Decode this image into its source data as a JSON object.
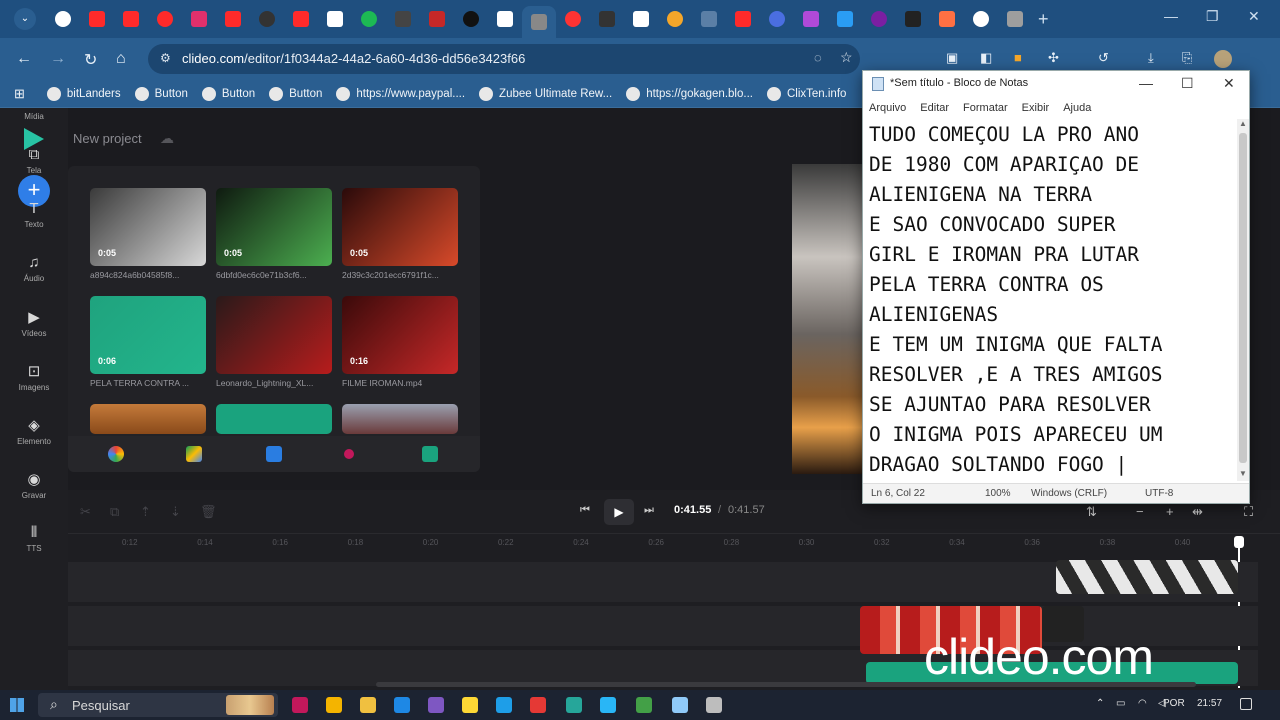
{
  "browser": {
    "url_domain": "clideo.com",
    "url_path": "/editor/1f0344a2-44a2-6a60-4d36-dd56e3423f66",
    "tab_colors": [
      "#ffffff",
      "#ff2a2a",
      "#ff2a2a",
      "#ff2a2a",
      "#e1306c",
      "#ff2a2a",
      "#333333",
      "#ff2a2a",
      "#ffffff",
      "#1db954",
      "#444444",
      "#c62828",
      "#111111",
      "#ffffff",
      "#888888",
      "#ff3333",
      "#333333",
      "#ffffff",
      "#f4a62a",
      "#5b7fa6",
      "#ff2a2a",
      "#4a6ee0",
      "#b04ad8",
      "#2a9df4",
      "#7b1fa2",
      "#222222",
      "#ff7043",
      "#ffffff",
      "#9e9e9e"
    ],
    "bookmarks": [
      "bitLanders",
      "Button",
      "Button",
      "Button",
      "https://www.paypal....",
      "Zubee Ultimate Rew...",
      "https://gokagen.blo...",
      "ClixTen.info"
    ]
  },
  "app": {
    "project_name": "New project",
    "sidebar": [
      {
        "icon": "image-icon",
        "glyph": "▣",
        "label": "Mídia"
      },
      {
        "icon": "screen-icon",
        "glyph": "⧉",
        "label": "Tela"
      },
      {
        "icon": "text-icon",
        "glyph": "T",
        "label": "Texto"
      },
      {
        "icon": "music-icon",
        "glyph": "♫",
        "label": "Áudio"
      },
      {
        "icon": "video-icon",
        "glyph": "▶",
        "label": "Vídeos"
      },
      {
        "icon": "picture-icon",
        "glyph": "⊡",
        "label": "Imagens"
      },
      {
        "icon": "shapes-icon",
        "glyph": "◈",
        "label": "Elemento"
      },
      {
        "icon": "record-icon",
        "glyph": "◉",
        "label": "Gravar"
      },
      {
        "icon": "tts-icon",
        "glyph": "⦀",
        "label": "TTS"
      }
    ],
    "media": [
      {
        "name": "a894c824a6b04585f8...",
        "duration": "0:05",
        "colors": [
          "#3a3a3a",
          "#d8d8d8"
        ]
      },
      {
        "name": "6dbfd0ec6c0e71b3cf6...",
        "duration": "0:05",
        "colors": [
          "#0f1a10",
          "#4caf50"
        ]
      },
      {
        "name": "2d39c3c201ecc6791f1c...",
        "duration": "0:05",
        "colors": [
          "#2a0a0a",
          "#d84a2a"
        ]
      },
      {
        "name": "PELA TERRA CONTRA ...",
        "duration": "0:06",
        "colors": [
          "#1fa37e",
          "#23b58c"
        ]
      },
      {
        "name": "Leonardo_Lightning_XL...",
        "duration": "",
        "colors": [
          "#2a1a1a",
          "#b71c1c"
        ]
      },
      {
        "name": "FILME IROMAN.mp4",
        "duration": "0:16",
        "colors": [
          "#3a0a0a",
          "#c62828"
        ]
      }
    ],
    "timecode_current": "0:41.55",
    "timecode_total": "0:41.57",
    "ruler_ticks": [
      "0:12",
      "0:14",
      "0:16",
      "0:18",
      "0:20",
      "0:22",
      "0:24",
      "0:26",
      "0:28",
      "0:30",
      "0:32",
      "0:34",
      "0:36",
      "0:38",
      "0:40"
    ],
    "watermark": "clideo.com"
  },
  "notepad": {
    "title": "*Sem título - Bloco de Notas",
    "menu": [
      "Arquivo",
      "Editar",
      "Formatar",
      "Exibir",
      "Ajuda"
    ],
    "lines": [
      "TUDO COMEÇOU LA PRO ANO",
      "DE 1980 COM APARIÇAO DE",
      "ALIENIGENA NA TERRA",
      "E SAO CONVOCADO SUPER",
      "GIRL E IROMAN PRA LUTAR",
      "PELA TERRA CONTRA OS",
      "ALIENIGENAS",
      "E TEM UM INIGMA QUE FALTA",
      "RESOLVER ,E A TRES AMIGOS",
      "SE AJUNTAO PARA RESOLVER",
      "O INIGMA POIS APARECEU UM",
      "DRAGAO SOLTANDO FOGO |"
    ],
    "status": {
      "position": "Ln 6, Col 22",
      "zoom": "100%",
      "line_endings": "Windows (CRLF)",
      "encoding": "UTF-8"
    }
  },
  "taskbar": {
    "search_placeholder": "Pesquisar",
    "language": "POR",
    "time": "21:57"
  }
}
